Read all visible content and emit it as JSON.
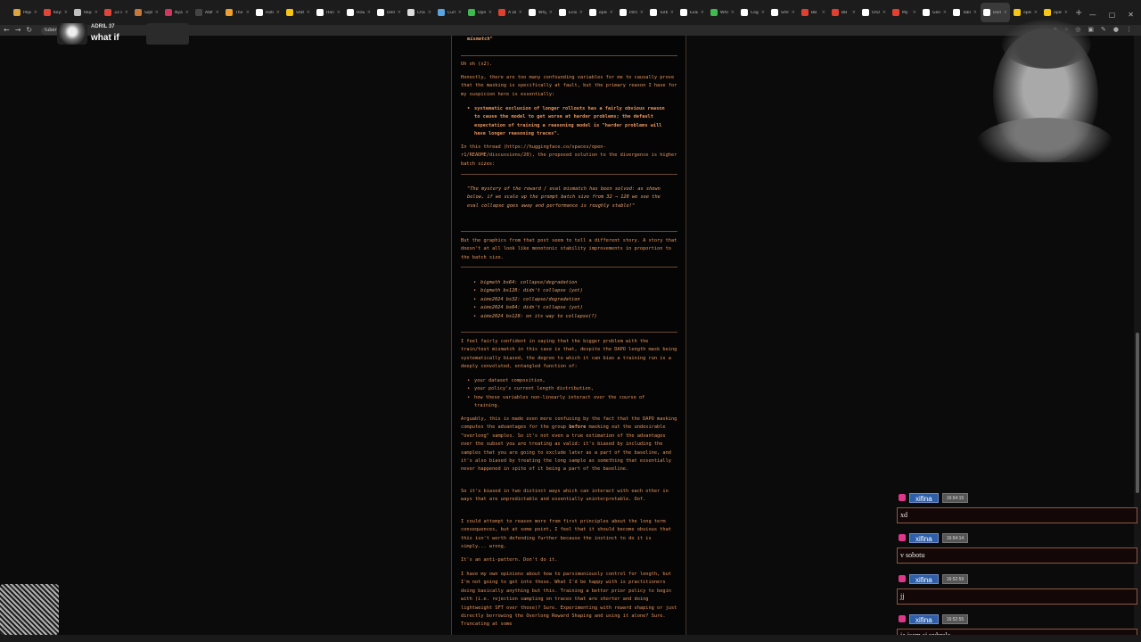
{
  "browser": {
    "tabs": [
      {
        "label": "Pepe",
        "color": "#d9a441"
      },
      {
        "label": "Keyy",
        "color": "#e0453a"
      },
      {
        "label": "Reyc",
        "color": "#c0c0c0"
      },
      {
        "label": "33 an",
        "color": "#e0453a"
      },
      {
        "label": "Sqlz",
        "color": "#c47a3d"
      },
      {
        "label": "Nyan",
        "color": "#d0365e"
      },
      {
        "label": "Albf",
        "color": "#444444"
      },
      {
        "label": "The",
        "color": "#f0a030"
      },
      {
        "label": "Hatc",
        "color": "#ffffff"
      },
      {
        "label": "Stats",
        "color": "#f5c518"
      },
      {
        "label": "Hany",
        "color": "#ffffff"
      },
      {
        "label": "How",
        "color": "#ffffff"
      },
      {
        "label": "Dem",
        "color": "#ffffff"
      },
      {
        "label": "Chan",
        "color": "#dddddd"
      },
      {
        "label": "Curls",
        "color": "#5aa5e0"
      },
      {
        "label": "Ope",
        "color": "#3fb950"
      },
      {
        "label": "A Dr",
        "color": "#e04030"
      },
      {
        "label": "Why",
        "color": "#ffffff"
      },
      {
        "label": "Econ",
        "color": "#ffffff"
      },
      {
        "label": "open",
        "color": "#ffffff"
      },
      {
        "label": "Intro",
        "color": "#ffffff"
      },
      {
        "label": "Turb",
        "color": "#ffffff"
      },
      {
        "label": "Exac",
        "color": "#ffffff"
      },
      {
        "label": "What",
        "color": "#3fb950"
      },
      {
        "label": "Cogn",
        "color": "#ffffff"
      },
      {
        "label": "Smm",
        "color": "#ffffff"
      },
      {
        "label": "BB",
        "color": "#e04030"
      },
      {
        "label": "BB",
        "color": "#e04030"
      },
      {
        "label": "OrDe",
        "color": "#ffffff"
      },
      {
        "label": "My",
        "color": "#e04030"
      },
      {
        "label": "Gen",
        "color": "#ffffff"
      },
      {
        "label": "Tabl",
        "color": "#ffffff"
      },
      {
        "label": "Dom",
        "color": "#ffffff",
        "active": true
      },
      {
        "label": "open",
        "color": "#f5c518"
      },
      {
        "label": "open",
        "color": "#f5c518"
      }
    ],
    "new_tab": "+",
    "url": "tuber"
  },
  "alert": {
    "name": "ADRIL 37",
    "message": "what if"
  },
  "doc": {
    "top_fragment": "mismatch\"",
    "p1": "Uh oh (x2).",
    "p2": "Honestly, there are too many confounding variables for me to causally prove that the masking is specifically at fault, but the primary reason I have for my suspicion here is essentially:",
    "bullet1": "systematic exclusion of longer rollouts has a fairly obvious reason to cause the model to get worse at harder problems; the default expectation of training a reasoning model is \"harder problems will have longer reasoning traces\".",
    "p3": "In this thread (https://huggingface.co/spaces/open-r1/README/discussions/20), the proposed solution to the divergence is higher batch sizes:",
    "quote": "\"The mystery of the reward / eval mismatch has been solved: as shown below, if we scale up the prompt batch size from 32 → 128 we see the eval collapse goes away and performance is roughly stable!\"",
    "p4": "But the graphics from that post seem to tell a different story. A story that doesn't at all look like monotonic stability improvements in proportion to the batch size.",
    "runs": [
      "bigmath bs64: collapse/degradation",
      "bigmath bs128: didn't collapse (yet)",
      "aime2024 bs32: collapse/degradation",
      "aime2024 bs64: didn't collapse (yet)",
      "aime2024 bs128: on its way to collapse(?)"
    ],
    "p5": "I feel fairly confident in saying that the bigger problem with the train/test mismatch in this case is that, despite the DAPO length mask being systematically biased, the degree to which it can bias a training run is a deeply convoluted, entangled function of:",
    "factors": [
      "your dataset composition,",
      "your policy's current length distribution,",
      "how these variables non-linearly interact over the course of training."
    ],
    "p6_a": "Arguably, this is made even more confusing by the fact that the DAPO masking computes the advantages for the group ",
    "p6_bold": "before",
    "p6_b": " masking out the undesirable \"overlong\" samples. So it's not even a true estimation of the advantages over the subset you are treating as valid: it's biased by including the samples that you are going to exclude later as a part of the baseline, and it's also biased by treating the long sample as something that essentially never happened in spite of it being a part of the baseline.",
    "p7": "So it's biased in two distinct ways which can interact with each other in ways that are unpredictable and essentially uninterpretable. Oof.",
    "p8": "I could attempt to reason more from first principles about the long term consequences, but at some point, I feel that it should become obvious that this isn't worth defending further because the instinct to do it is simply... wrong.",
    "p9": "It's an anti-pattern. Don't do it.",
    "p10": "I have my own opinions about how to parsimoniously control for length, but I'm not going to get into those. What I'd be happy with is practitioners doing basically anything but this. Training a better prior policy to begin with (i.e. rejection sampling on traces that are shorter and doing lightweight SFT over those)? Sure. Experimenting with reward shaping or just directly borrowing the Overlong Reward Shaping and using it alone? Sure. Truncating at some"
  },
  "chat": [
    {
      "user": "xifina",
      "time": "16:54:15",
      "message": "xd"
    },
    {
      "user": "xifina",
      "time": "16:54:14",
      "message": "v sobotu"
    },
    {
      "user": "xifina",
      "time": "16:52:59",
      "message": "jj"
    },
    {
      "user": "xifina",
      "time": "16:52:55",
      "message": "ja jsem si vybrala"
    }
  ],
  "colors": {
    "doc_text": "#e8945a",
    "chat_user_bg": "#2e5fa8",
    "chat_badge": "#e0368c"
  }
}
